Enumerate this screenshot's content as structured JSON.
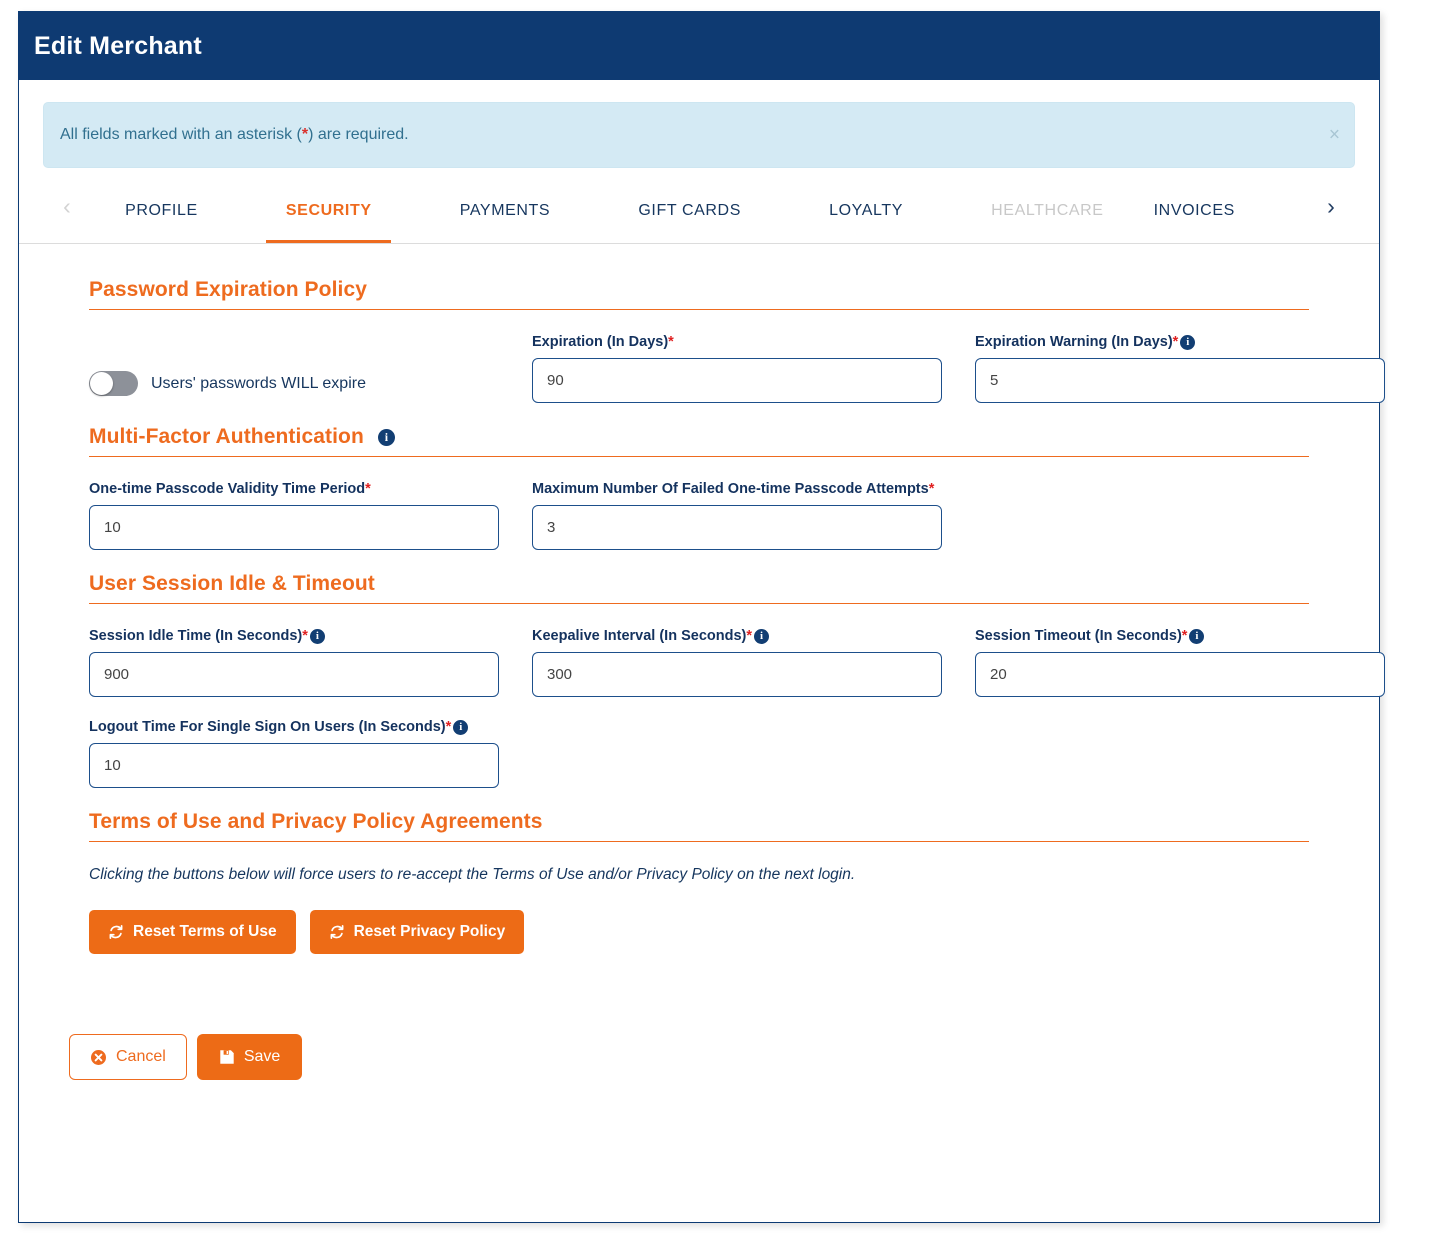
{
  "header": {
    "title": "Edit Merchant"
  },
  "alert": {
    "text_before": "All fields marked with an asterisk (",
    "asterisk": "*",
    "text_after": ") are required.",
    "close_label": "×"
  },
  "tabs": {
    "prev_label": "‹",
    "next_label": "›",
    "items": [
      {
        "label": "PROFILE",
        "state": "normal"
      },
      {
        "label": "SECURITY",
        "state": "active"
      },
      {
        "label": "PAYMENTS",
        "state": "normal"
      },
      {
        "label": "GIFT CARDS",
        "state": "normal"
      },
      {
        "label": "LOYALTY",
        "state": "normal"
      },
      {
        "label": "HEALTHCARE",
        "state": "disabled"
      },
      {
        "label": "INVOICES",
        "state": "clipped"
      }
    ]
  },
  "sections": {
    "password": {
      "heading": "Password Expiration Policy",
      "toggle_label": "Users' passwords WILL expire",
      "toggle_state": "off",
      "expiration_label": "Expiration (In Days)",
      "expiration_value": "90",
      "warning_label": "Expiration Warning (In Days)",
      "warning_value": "5"
    },
    "mfa": {
      "heading": "Multi-Factor Authentication",
      "otp_validity_label": "One-time Passcode Validity Time Period",
      "otp_validity_value": "10",
      "max_failed_label": "Maximum Number Of Failed One-time Passcode Attempts",
      "max_failed_value": "3"
    },
    "session": {
      "heading": "User Session Idle & Timeout",
      "idle_label": "Session Idle Time (In Seconds)",
      "idle_value": "900",
      "keepalive_label": "Keepalive Interval (In Seconds)",
      "keepalive_value": "300",
      "timeout_label": "Session Timeout (In Seconds)",
      "timeout_value": "20",
      "sso_label": "Logout Time For Single Sign On Users (In Seconds)",
      "sso_value": "10"
    },
    "terms": {
      "heading": "Terms of Use and Privacy Policy Agreements",
      "note": "Clicking the buttons below will force users to re-accept the Terms of Use and/or Privacy Policy on the next login.",
      "reset_terms_label": "Reset Terms of Use",
      "reset_privacy_label": "Reset Privacy Policy"
    }
  },
  "footer": {
    "cancel_label": "Cancel",
    "save_label": "Save"
  },
  "icons": {
    "info": "i"
  },
  "colors": {
    "header_navy": "#0e3a72",
    "accent_orange": "#ee6b1f",
    "alert_bg": "#d4eaf4",
    "required_red": "#e02020",
    "label_navy": "#14325e"
  }
}
